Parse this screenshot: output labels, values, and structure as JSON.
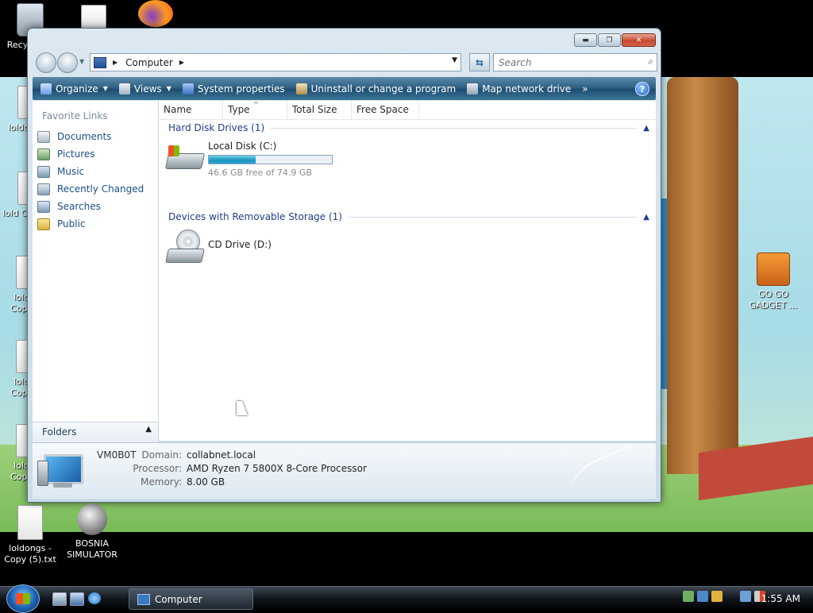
{
  "desktop": {
    "icons": [
      {
        "label": "Recy"
      },
      {
        "label": ""
      },
      {
        "label": ""
      },
      {
        "label": "loldc"
      },
      {
        "label": "lold Co"
      },
      {
        "label": "lold Copy"
      },
      {
        "label": "lold Copy"
      },
      {
        "label": "lold Copy"
      },
      {
        "label": "GO GO GADGET ..."
      },
      {
        "label": "loldongs - Copy (5).txt"
      },
      {
        "label": "BOSNIA SIMULATOR"
      }
    ]
  },
  "window": {
    "address": {
      "crumb": "Computer"
    },
    "search": {
      "placeholder": "Search"
    },
    "toolbar": {
      "organize": "Organize",
      "views": "Views",
      "system_properties": "System properties",
      "uninstall": "Uninstall or change a program",
      "map_drive": "Map network drive",
      "more": "»",
      "help": "?"
    },
    "nav": {
      "favorites_title": "Favorite Links",
      "links": [
        "Documents",
        "Pictures",
        "Music",
        "Recently Changed",
        "Searches",
        "Public"
      ],
      "folders": "Folders"
    },
    "columns": [
      "Name",
      "Type",
      "Total Size",
      "Free Space"
    ],
    "groups": {
      "hdd": "Hard Disk Drives (1)",
      "removable": "Devices with Removable Storage (1)"
    },
    "drives": {
      "c": {
        "name": "Local Disk (C:)",
        "free_text": "46.6 GB free of 74.9 GB",
        "used_fraction": 0.38
      },
      "d": {
        "name": "CD Drive (D:)"
      }
    },
    "details": {
      "name": "VM0B0T",
      "domain_label": "Domain:",
      "domain": "collabnet.local",
      "processor_label": "Processor:",
      "processor": "AMD Ryzen 7 5800X 8-Core Processor",
      "memory_label": "Memory:",
      "memory": "8.00 GB"
    }
  },
  "taskbar": {
    "task_label": "Computer",
    "clock": "1:55 AM"
  }
}
